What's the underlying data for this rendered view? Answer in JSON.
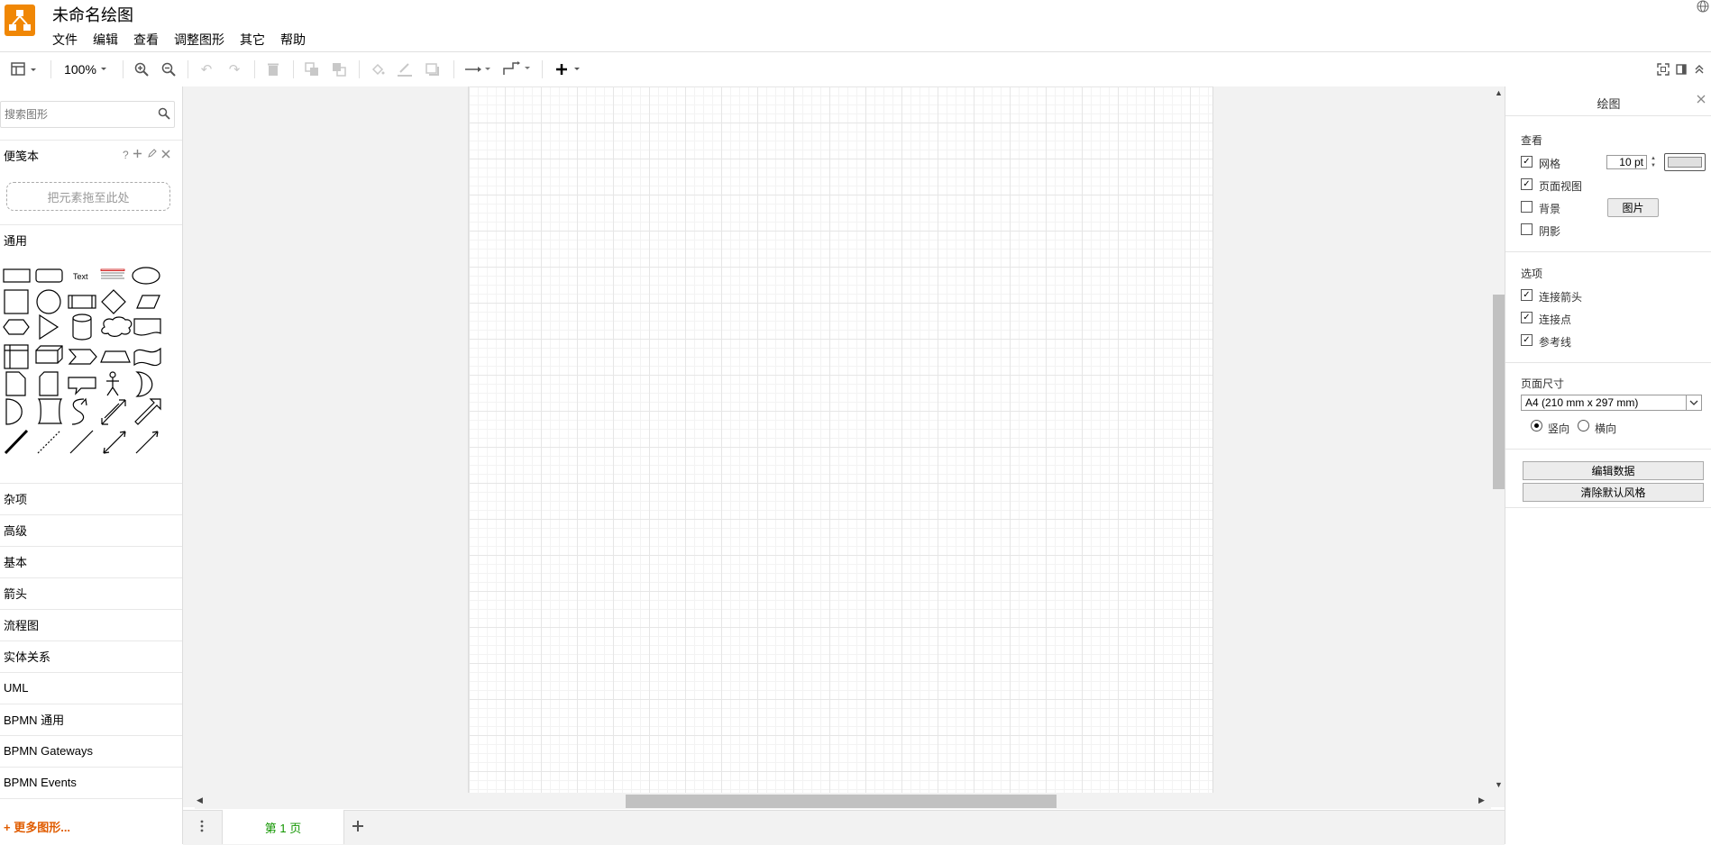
{
  "header": {
    "title": "未命名绘图",
    "menus": [
      "文件",
      "编辑",
      "查看",
      "调整图形",
      "其它",
      "帮助"
    ]
  },
  "toolbar": {
    "zoom": "100%",
    "icons": [
      "format-panel-icon",
      "zoom-in-icon",
      "zoom-out-icon",
      "undo-icon",
      "redo-icon",
      "delete-icon",
      "to-front-icon",
      "to-back-icon",
      "fill-color-icon",
      "line-color-icon",
      "shadow-icon",
      "connection-icon",
      "waypoints-icon",
      "insert-icon",
      "fullscreen-icon",
      "toggle-format-icon",
      "collapse-icon"
    ]
  },
  "sidebar": {
    "search_placeholder": "搜索图形",
    "scratchpad": {
      "title": "便笺本",
      "help": "?",
      "drop_text": "把元素拖至此处"
    },
    "general": {
      "title": "通用",
      "text_shape": "Text"
    },
    "sections": [
      "杂项",
      "高级",
      "基本",
      "箭头",
      "流程图",
      "实体关系",
      "UML",
      "BPMN 通用",
      "BPMN Gateways",
      "BPMN Events"
    ],
    "more_shapes": "+ 更多图形..."
  },
  "pages": {
    "tab_label": "第 1 页"
  },
  "format_panel": {
    "title": "绘图",
    "view_section": "查看",
    "grid_label": "网格",
    "grid_checked": true,
    "grid_size": "10 pt",
    "page_view_label": "页面视图",
    "page_view_checked": true,
    "background_label": "背景",
    "background_checked": false,
    "image_button": "图片",
    "shadow_label": "阴影",
    "shadow_checked": false,
    "options_section": "选项",
    "connection_arrows_label": "连接箭头",
    "connection_points_label": "连接点",
    "guides_label": "参考线",
    "paper_size_section": "页面尺寸",
    "paper_size_value": "A4 (210 mm x 297 mm)",
    "portrait_label": "竖向",
    "landscape_label": "横向",
    "orientation": "portrait",
    "edit_data_button": "编辑数据",
    "clear_style_button": "清除默认风格"
  },
  "colors": {
    "logo": "#f08705",
    "page_tab": "#129600",
    "more_shapes": "#e05c00"
  }
}
